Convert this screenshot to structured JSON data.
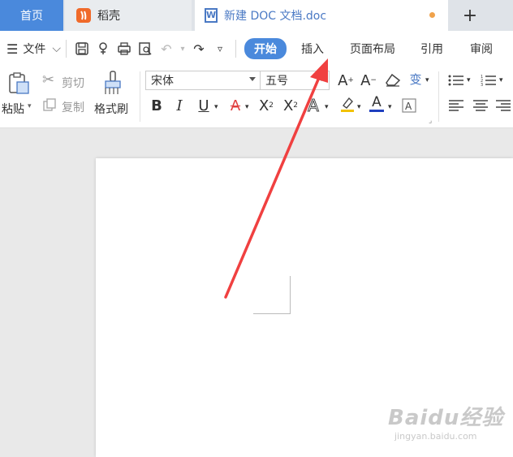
{
  "tabs": {
    "home": "首页",
    "daoke": "稻壳",
    "doc": "新建 DOC 文档.doc",
    "add": "+"
  },
  "toolbar": {
    "file": "文件",
    "ribbon_tabs": [
      "开始",
      "插入",
      "页面布局",
      "引用",
      "审阅"
    ]
  },
  "ribbon": {
    "paste": "粘贴",
    "cut": "剪切",
    "copy": "复制",
    "format_painter": "格式刷",
    "font_name": "宋体",
    "font_size": "五号"
  },
  "watermark": {
    "brand": "Baidu经验",
    "url": "jingyan.baidu.com"
  },
  "colors": {
    "accent": "#4a89dc",
    "arrow": "#f04040",
    "font_color_underline": "#1f3fbf",
    "highlight_underline": "#f2c200"
  }
}
